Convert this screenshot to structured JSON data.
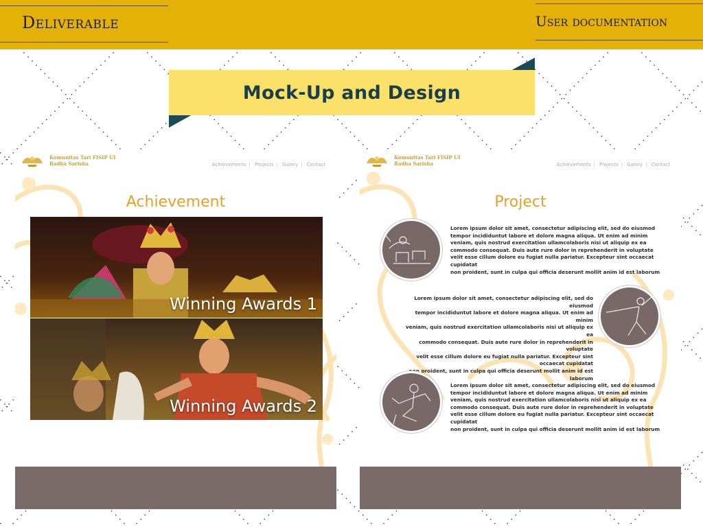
{
  "header": {
    "left_title": "Deliverable",
    "right_title": "User documentation"
  },
  "banner": {
    "title": "Mock-Up and Design"
  },
  "site": {
    "name_line1": "Komunitas Tari FISIP UI",
    "name_line2": "Radha Sarisha",
    "nav": [
      "Achievements",
      "Projects",
      "Galery",
      "Contact"
    ]
  },
  "achievement_page": {
    "title": "Achievement",
    "awards": [
      {
        "caption": "Winning Awards 1"
      },
      {
        "caption": "Winning Awards 2"
      }
    ]
  },
  "project_page": {
    "title": "Project",
    "items": [
      {
        "icon": "drummer-icon",
        "lines": [
          "Lorem ipsum dolor sit amet, consectetur adipiscing elit, sed do eiusmod",
          "tempor incididuntut labore et dolore magna aliqua. Ut enim ad minim",
          "veniam, quis nostrud exercitation ullamcolaboris nisi ut aliquip ex ea",
          "commodo consequat. Duis aute rure dolor in reprehenderit in voluptate",
          "velit esse cillum dolore eu fugiat nulla pariatur. Excepteur sint occaecat cupidatat",
          "non proident, sunt in culpa qui officia deserunt mollit anim id est laborum"
        ]
      },
      {
        "icon": "dancer-icon",
        "lines": [
          "Lorem ipsum dolor sit amet, consectetur adipiscing elit, sed do eiusmod",
          "tempor incididuntut labore et dolore magna aliqua. Ut enim ad minim",
          "veniam, quis nostrud exercitation ullamcolaboris nisi ut aliquip ex ea",
          "commodo consequat. Duis aute rure dolor in reprehenderit in voluptate",
          "velit esse cillum dolore eu fugiat nulla pariatur. Excepteur sint occaecat cupidatat",
          "non proident, sunt in culpa qui officia deserunt mollit anim id est laborum"
        ]
      },
      {
        "icon": "kneeling-dancer-icon",
        "lines": [
          "Lorem ipsum dolor sit amet, consectetur adipiscing elit, sed do eiusmod",
          "tempor incididuntut labore et dolore magna aliqua. Ut enim ad minim",
          "veniam, quis nostrud exercitation ullamcolaboris nisi ut aliquip ex ea",
          "commodo consequat. Duis aute rure dolor in reprehenderit in voluptate",
          "velit esse cillum dolore eu fugiat nulla pariatur. Excepteur sint occaecat cupidatat",
          "non proident, sunt in culpa qui officia deserunt mollit anim id est laborum"
        ]
      }
    ]
  },
  "colors": {
    "header_bar": "#e3b108",
    "banner": "#fbe06a",
    "banner_text": "#1a3f48",
    "accent_orange": "#e6a12b",
    "footer_brown": "#7a6a6a"
  }
}
